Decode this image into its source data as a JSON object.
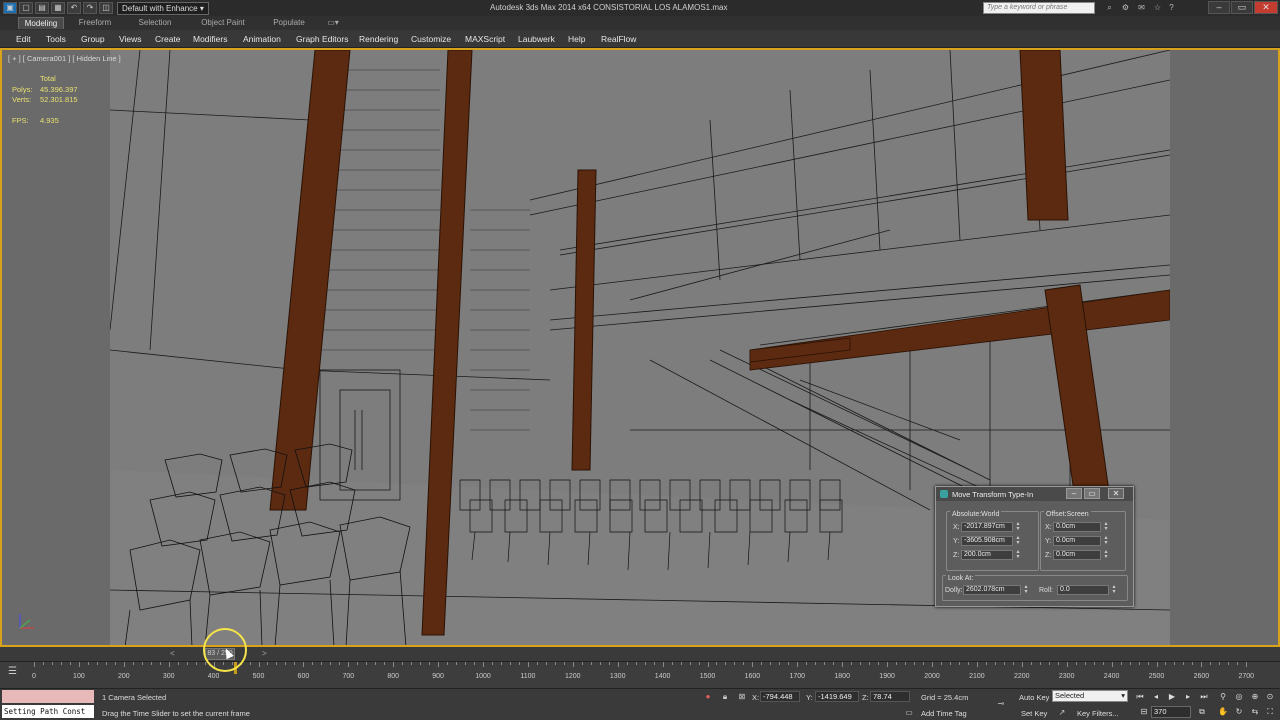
{
  "titlebar": {
    "workspace": "Default with Enhance",
    "app_title": "Autodesk 3ds Max 2014 x64     CONSISTORIAL LOS ALAMOS1.max",
    "search_placeholder": "Type a keyword or phrase",
    "quick_access_icons": [
      "app-menu-icon",
      "new-icon",
      "open-icon",
      "save-icon",
      "undo-icon",
      "redo-icon",
      "hold-icon"
    ]
  },
  "ribbon_tabs": [
    "Modeling",
    "Freeform",
    "Selection",
    "Object Paint",
    "Populate"
  ],
  "menu": [
    "Edit",
    "Tools",
    "Group",
    "Views",
    "Create",
    "Modifiers",
    "Animation",
    "Graph Editors",
    "Rendering",
    "Customize",
    "MAXScript",
    "Laubwerk",
    "Help",
    "RealFlow"
  ],
  "viewport": {
    "label": "[ + ] [ Camera001 ] [ Hidden Line ]",
    "stats": {
      "total_label": "Total",
      "polys_label": "Polys:",
      "polys_value": "45.396.397",
      "verts_label": "Verts:",
      "verts_value": "52.301.815",
      "fps_label": "FPS:",
      "fps_value": "4.935"
    }
  },
  "move_transform": {
    "title": "Move Transform Type-In",
    "absolute_label": "Absolute:World",
    "offset_label": "Offset:Screen",
    "abs_x": "-2017.897cm",
    "abs_y": "-3605.908cm",
    "abs_z": "200.0cm",
    "off_x": "0.0cm",
    "off_y": "0.0cm",
    "off_z": "0.0cm",
    "x_label": "X:",
    "y_label": "Y:",
    "z_label": "Z:",
    "lookat_label": "Look At:",
    "dolly_label": "Dolly:",
    "dolly_value": "2602.078cm",
    "roll_label": "Roll:",
    "roll_value": "0.0"
  },
  "timeslider": {
    "handle_text": "83 / 250",
    "prev": "<",
    "next": ">"
  },
  "trackbar": {
    "ticks": [
      "0",
      "100",
      "200",
      "300",
      "400",
      "500",
      "600",
      "700",
      "800",
      "900",
      "1000",
      "1100",
      "1200",
      "1300",
      "1400",
      "1500",
      "1600",
      "1700",
      "1800",
      "1900",
      "2000",
      "2100",
      "2200",
      "2300",
      "2400",
      "2500",
      "2600",
      "2700"
    ]
  },
  "statusbar": {
    "script_line": "Setting Path Const",
    "selection_status": "1 Camera Selected",
    "prompt": "Drag the Time Slider to set the current frame",
    "x_label": "X:",
    "x_value": "-794.448",
    "y_label": "Y:",
    "y_value": "-1419.649",
    "z_label": "Z:",
    "z_value": "78.74",
    "grid": "Grid = 25.4cm",
    "add_time_tag": "Add Time Tag",
    "auto_key": "Auto Key",
    "set_key": "Set Key",
    "selected": "Selected",
    "key_filters": "Key Filters...",
    "frame": "370"
  },
  "colors": {
    "viewport_bg": "#7a7a7a",
    "active_viewport_border": "#d9a21b",
    "stats_text": "#e8e070",
    "wood": "#5c2a10"
  }
}
